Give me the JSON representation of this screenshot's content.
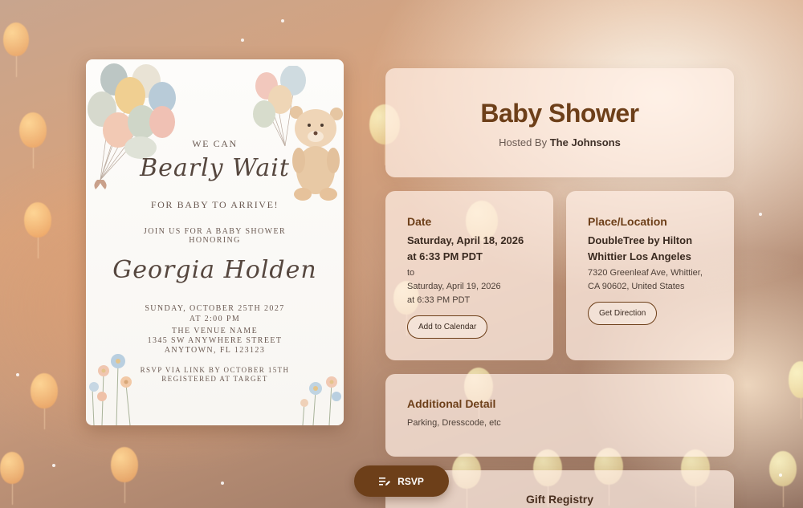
{
  "invitation": {
    "line1": "WE CAN",
    "script1": "Bearly Wait",
    "line2": "FOR BABY TO ARRIVE!",
    "join1": "JOIN US FOR A BABY SHOWER",
    "join2": "HONORING",
    "honoree": "Georgia Holden",
    "date1": "SUNDAY, OCTOBER 25TH 2027",
    "date2": "AT 2:00 PM",
    "venue1": "THE VENUE NAME",
    "venue2": "1345 SW ANYWHERE STREET",
    "venue3": "ANYTOWN, FL 123123",
    "rsvp1": "RSVP VIA LINK BY OCTOBER 15TH",
    "rsvp2": "REGISTERED AT TARGET"
  },
  "event": {
    "title": "Baby Shower",
    "hosted_prefix": "Hosted By",
    "host": "The Johnsons"
  },
  "date": {
    "heading": "Date",
    "start_line1": "Saturday, April 18, 2026",
    "start_line2": "at 6:33 PM PDT",
    "to": "to",
    "end_line1": "Saturday, April 19, 2026",
    "end_line2": "at 6:33 PM PDT",
    "button": "Add to Calendar"
  },
  "location": {
    "heading": "Place/Location",
    "name_line1": "DoubleTree by Hilton",
    "name_line2": "Whittier Los Angeles",
    "address_line1": "7320 Greenleaf Ave, Whittier,",
    "address_line2": "CA 90602, United States",
    "button": "Get Direction"
  },
  "additional": {
    "heading": "Additional Detail",
    "text": "Parking, Dresscode, etc"
  },
  "gift": {
    "heading": "Gift Registry"
  },
  "rsvp": {
    "label": "RSVP",
    "icon": "edit-list-icon"
  },
  "colors": {
    "accent": "#6d3f19",
    "panel_bg": "#ffeee4"
  }
}
